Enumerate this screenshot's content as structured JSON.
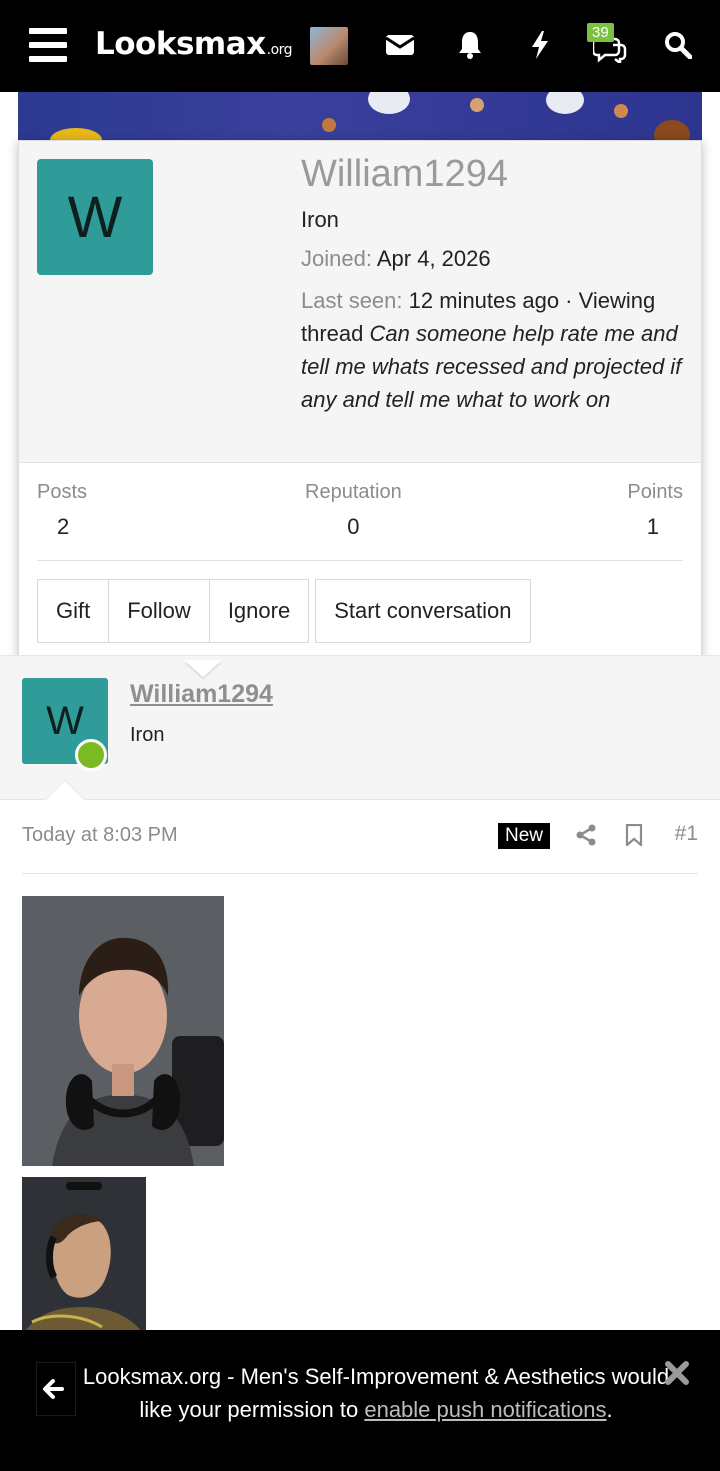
{
  "nav": {
    "logo_main": "Looksmax",
    "logo_suffix": ".org",
    "conversations_badge": "39"
  },
  "profile_card": {
    "avatar_letter": "W",
    "username": "William1294",
    "user_title": "Iron",
    "joined_label": "Joined:",
    "joined_value": "Apr 4, 2026",
    "last_seen_label": "Last seen:",
    "last_seen_value": "12 minutes ago · Viewing thread",
    "last_seen_thread": "Can someone help rate me and tell me whats recessed and projected if any and tell me what to work on",
    "stats": [
      {
        "label": "Posts",
        "value": "2"
      },
      {
        "label": "Reputation",
        "value": "0"
      },
      {
        "label": "Points",
        "value": "1"
      }
    ],
    "buttons": {
      "gift": "Gift",
      "follow": "Follow",
      "ignore": "Ignore",
      "start_conversation": "Start conversation"
    }
  },
  "post": {
    "avatar_letter": "W",
    "username": "William1294",
    "user_title": "Iron",
    "time": "Today at 8:03 PM",
    "new_badge": "New",
    "post_number": "#1"
  },
  "push_prompt": {
    "text_before": "Looksmax.org - Men's Self-Improvement & Aesthetics would like your permission to ",
    "link_text": "enable push notifications",
    "text_after": "."
  }
}
